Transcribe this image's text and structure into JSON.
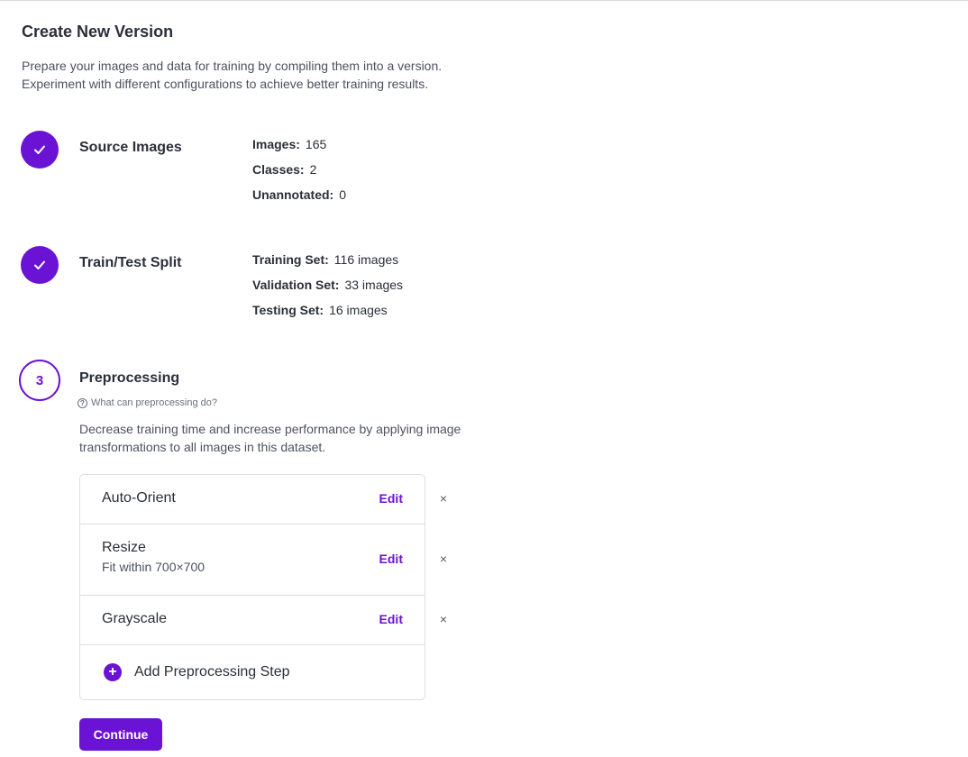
{
  "page": {
    "title": "Create New Version",
    "intro_line1": "Prepare your images and data for training by compiling them into a version.",
    "intro_line2": "Experiment with different configurations to achieve better training results."
  },
  "steps": {
    "source": {
      "title": "Source Images",
      "stats": [
        {
          "label": "Images:",
          "value": "165"
        },
        {
          "label": "Classes:",
          "value": "2"
        },
        {
          "label": "Unannotated:",
          "value": "0"
        }
      ]
    },
    "split": {
      "title": "Train/Test Split",
      "stats": [
        {
          "label": "Training Set:",
          "value": "116 images"
        },
        {
          "label": "Validation Set:",
          "value": "33 images"
        },
        {
          "label": "Testing Set:",
          "value": "16 images"
        }
      ]
    },
    "preprocessing": {
      "number": "3",
      "title": "Preprocessing",
      "help_link": "What can preprocessing do?",
      "description": "Decrease training time and increase performance by applying image transformations to all images in this dataset.",
      "items": [
        {
          "name": "Auto-Orient",
          "sub": "",
          "edit": "Edit"
        },
        {
          "name": "Resize",
          "sub": "Fit within 700×700",
          "edit": "Edit"
        },
        {
          "name": "Grayscale",
          "sub": "",
          "edit": "Edit"
        }
      ],
      "add_label": "Add Preprocessing Step",
      "remove_glyph": "×"
    }
  },
  "actions": {
    "continue_label": "Continue"
  },
  "icons": {
    "check": "check-icon",
    "help": "question-circle-icon",
    "plus": "plus-circle-icon",
    "close": "close-icon"
  },
  "colors": {
    "accent": "#6b13d4"
  }
}
